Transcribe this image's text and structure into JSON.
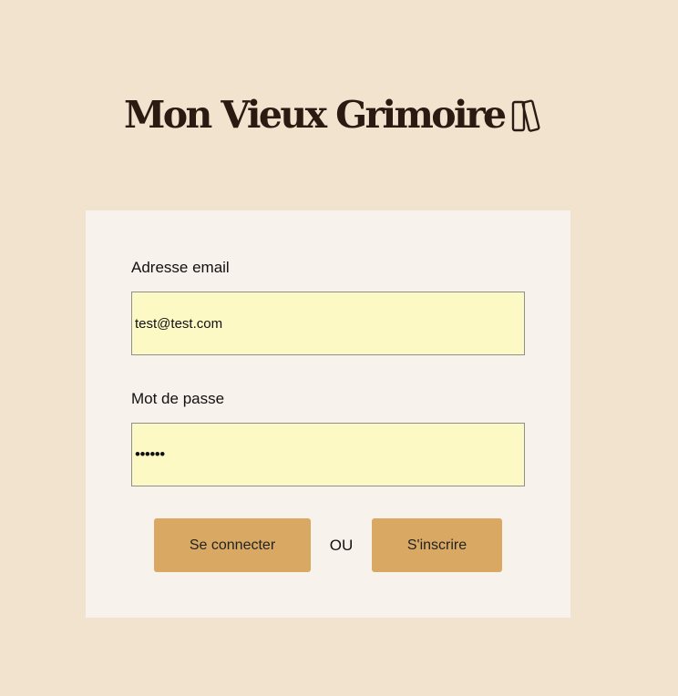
{
  "header": {
    "title": "Mon Vieux Grimoire",
    "logo_icon": "books-icon"
  },
  "form": {
    "email_label": "Adresse email",
    "email_value": "test@test.com",
    "password_label": "Mot de passe",
    "password_value": "••••••",
    "login_button": "Se connecter",
    "or_text": "OU",
    "register_button": "S'inscrire"
  },
  "colors": {
    "page_background": "#f2e3cf",
    "card_background": "#f7f2eb",
    "input_background": "#fdf9c4",
    "button_background": "#d9a963",
    "title_color": "#2b1a12"
  }
}
